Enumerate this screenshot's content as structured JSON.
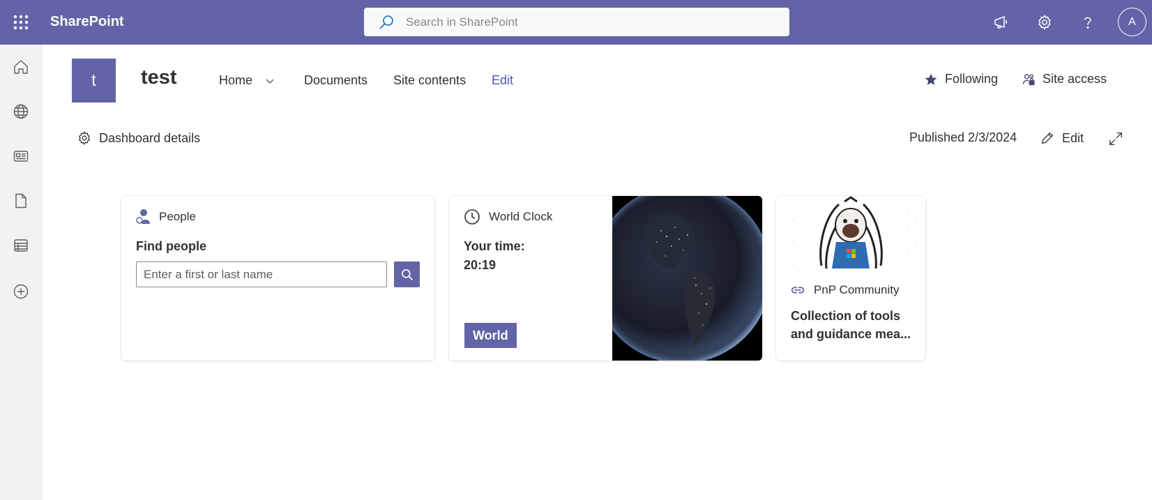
{
  "suite_bar": {
    "app_name": "SharePoint",
    "search_placeholder": "Search in SharePoint",
    "avatar_initial": "A",
    "background": "#6264a7"
  },
  "left_rail": {
    "items": [
      "home-icon",
      "globe-icon",
      "news-icon",
      "document-icon",
      "list-icon",
      "add-icon"
    ]
  },
  "site": {
    "logo_letter": "t",
    "title": "test",
    "nav": {
      "home": "Home",
      "documents": "Documents",
      "site_contents": "Site contents",
      "edit": "Edit"
    },
    "following_label": "Following",
    "site_access_label": "Site access"
  },
  "command_bar": {
    "dashboard_details": "Dashboard details",
    "published": "Published 2/3/2024",
    "edit": "Edit"
  },
  "cards": {
    "people": {
      "title": "People",
      "subtitle": "Find people",
      "input_placeholder": "Enter a first or last name"
    },
    "world_clock": {
      "title": "World Clock",
      "your_time_label": "Your time:",
      "time": "20:19",
      "button": "World"
    },
    "pnp": {
      "title": "PnP Community",
      "description": "Collection of tools and guidance mea..."
    }
  },
  "colors": {
    "accent": "#6264a7",
    "link": "#4f52b2",
    "text": "#323130"
  }
}
